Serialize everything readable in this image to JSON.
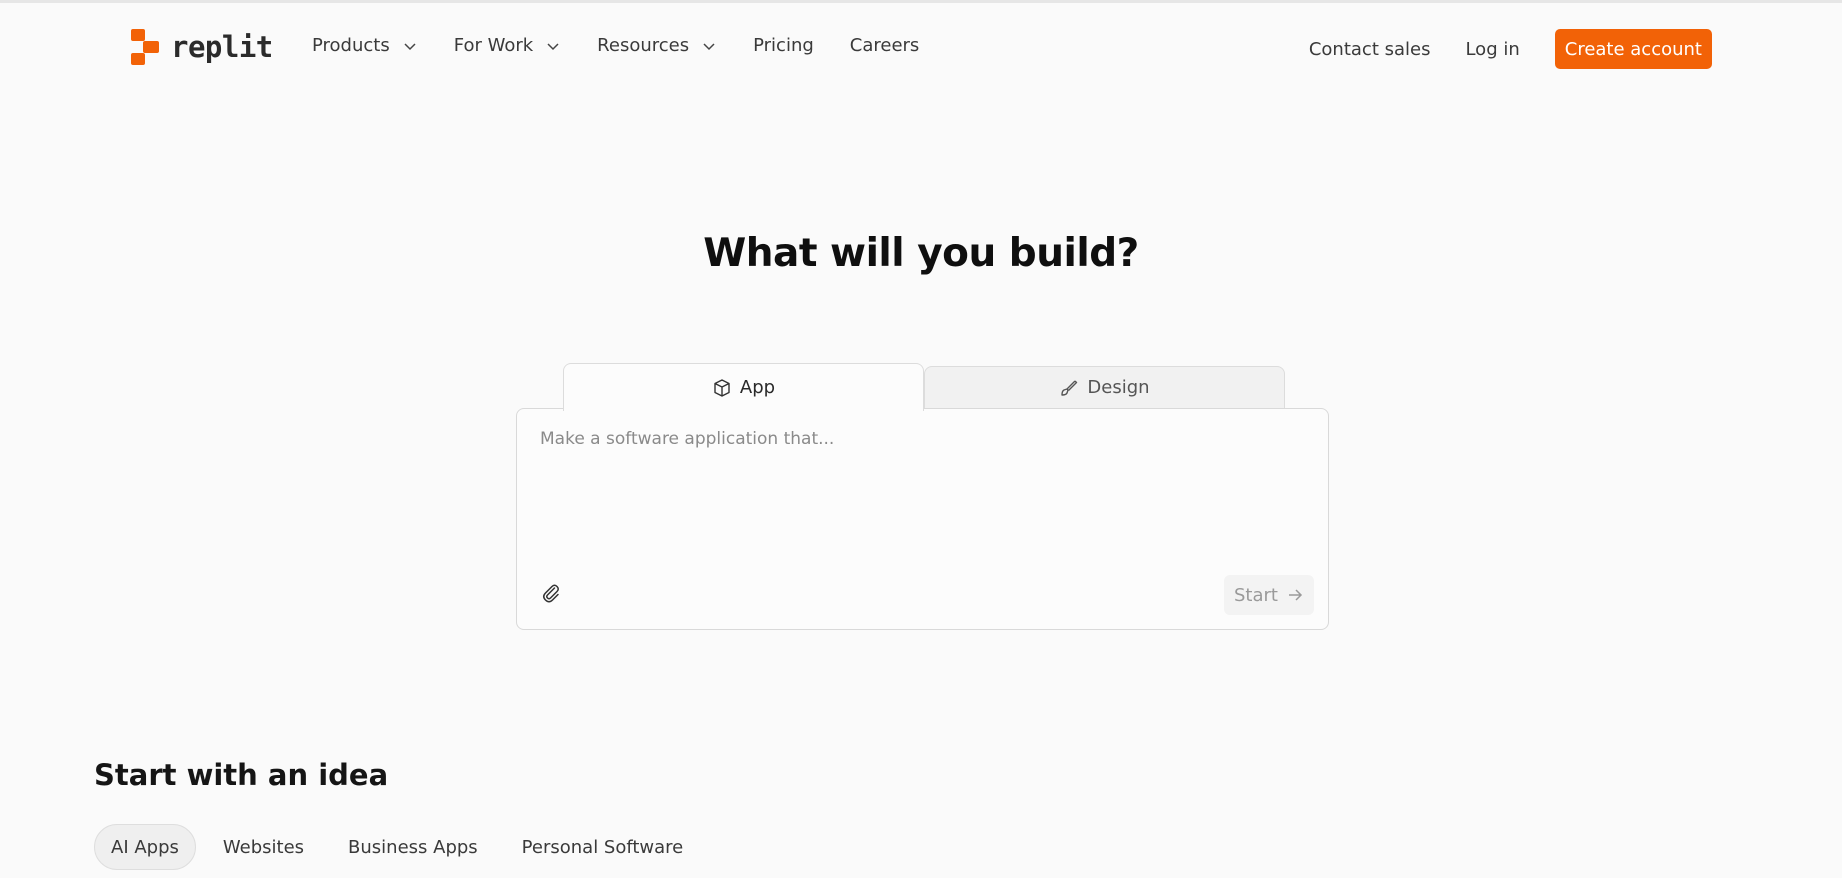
{
  "brand": {
    "name": "replit",
    "color": "#f26207"
  },
  "nav": {
    "items": [
      {
        "label": "Products",
        "dropdown": true
      },
      {
        "label": "For Work",
        "dropdown": true
      },
      {
        "label": "Resources",
        "dropdown": true
      },
      {
        "label": "Pricing",
        "dropdown": false
      },
      {
        "label": "Careers",
        "dropdown": false
      }
    ],
    "contact_sales": "Contact sales",
    "login": "Log in",
    "create_account": "Create account"
  },
  "hero": {
    "title": "What will you build?"
  },
  "composer": {
    "tabs": [
      {
        "label": "App",
        "icon": "cube-icon",
        "active": true
      },
      {
        "label": "Design",
        "icon": "brush-icon",
        "active": false
      }
    ],
    "placeholder": "Make a software application that...",
    "start_label": "Start"
  },
  "ideas": {
    "title": "Start with an idea",
    "chips": [
      {
        "label": "AI Apps",
        "active": true
      },
      {
        "label": "Websites",
        "active": false
      },
      {
        "label": "Business Apps",
        "active": false
      },
      {
        "label": "Personal Software",
        "active": false
      }
    ]
  }
}
